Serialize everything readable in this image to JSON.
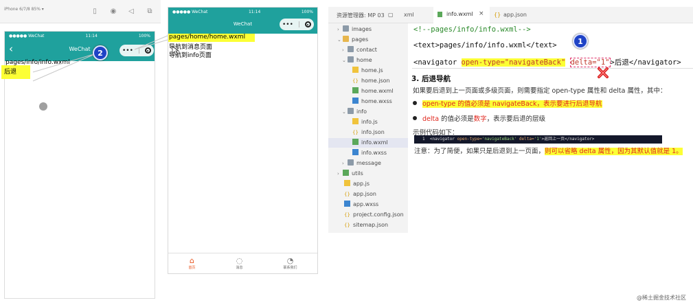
{
  "sim1": {
    "device_label": "iPhone 6/7/8 85% ▾",
    "status_left": "●●●●● WeChat",
    "status_time": "11:14",
    "status_right": "100%",
    "nav_title": "WeChat",
    "back_icon": "back-chevron-icon",
    "path_text": "pages/info/info.wxml",
    "back_text": "后退"
  },
  "sim2": {
    "status_left": "●●●●● WeChat",
    "status_time": "11:14",
    "status_right": "100%",
    "nav_title": "WeChat",
    "path_text": "pages/home/home.wxml",
    "link1": "导航到消息页面",
    "link2": "导航到info页面",
    "tabs": [
      {
        "label": "首页",
        "icon": "home-icon"
      },
      {
        "label": "消息",
        "icon": "message-icon"
      },
      {
        "label": "联系我们",
        "icon": "phone-icon"
      }
    ]
  },
  "editor": {
    "tabs": [
      {
        "label": "资源管理器: MP 03"
      },
      {
        "label": "xml"
      },
      {
        "label": "info.wxml"
      },
      {
        "label": "app.json"
      }
    ],
    "tree": [
      {
        "label": "images"
      },
      {
        "label": "pages"
      },
      {
        "label": "contact"
      },
      {
        "label": "home"
      },
      {
        "label": "home.js"
      },
      {
        "label": "home.json"
      },
      {
        "label": "home.wxml"
      },
      {
        "label": "home.wxss"
      },
      {
        "label": "info"
      },
      {
        "label": "info.js"
      },
      {
        "label": "info.json"
      },
      {
        "label": "info.wxml"
      },
      {
        "label": "info.wxss"
      },
      {
        "label": "message"
      },
      {
        "label": "utils"
      },
      {
        "label": "app.js"
      },
      {
        "label": "app.json"
      },
      {
        "label": "app.wxss"
      },
      {
        "label": "project.config.json"
      },
      {
        "label": "sitemap.json"
      }
    ],
    "code": {
      "line1": "<!--pages/info/info.wxml-->",
      "line2": "<text>pages/info/info.wxml</text>",
      "line3_open": "<navigator ",
      "line3_attr1": "open-type=\"navigateBack\"",
      "line3_attr2": "delta=\"1\"",
      "line3_close": ">后退</navigator>"
    }
  },
  "doc": {
    "heading": "3. 后退导航",
    "intro": "如果要后退到上一页面或多级页面，则需要指定 open-type 属性和 delta 属性，其中：",
    "bullet1": "open-type 的值必须是 navigateBack，表示要进行后退导航",
    "bullet2_a": "delta",
    "bullet2_b": " 的值必须是",
    "bullet2_c": "数字",
    "bullet2_d": "，表示要后退的层级",
    "example_label": "示例代码如下：",
    "example_num": "1",
    "example_open": "<navigator ",
    "example_attr1": "open-type=",
    "example_val1": "'navigateBack'",
    "example_attr2": " delta=",
    "example_val2": "'1'",
    "example_close": ">返回上一页</navigator>",
    "note_a": "注意：为了简便，如果只是后退到上一页面，",
    "note_b": "则可以省略 delta 属性，因为其默认值就是 1。"
  },
  "annotations": {
    "badge1": "1",
    "badge2": "2"
  },
  "watermark": "@稀土掘金技术社区",
  "colors": {
    "nav_teal": "#1fa19d",
    "highlight_yellow": "#fcff35",
    "badge_blue": "#1f43c6",
    "accent_red": "#e0261c",
    "tab_active": "#e8541e"
  }
}
